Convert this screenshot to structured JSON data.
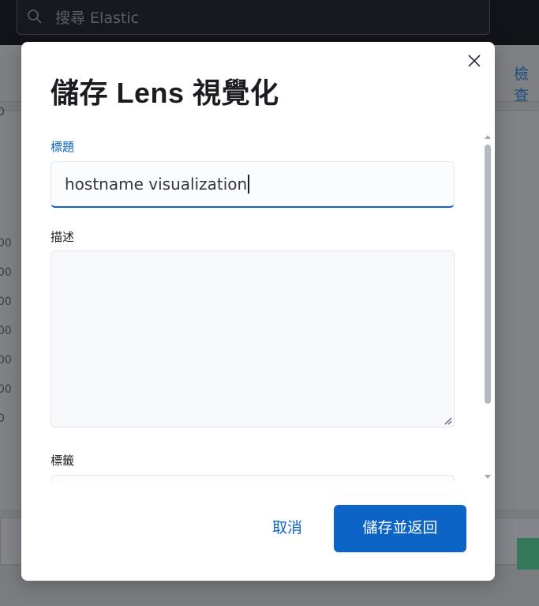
{
  "background": {
    "search": {
      "placeholder": "搜尋 Elastic"
    },
    "toolbar": {
      "inspect_label": "檢查"
    },
    "axis_ticks": [
      "0",
      "00",
      "00",
      "00",
      "00",
      "00",
      "00",
      "0"
    ]
  },
  "modal": {
    "title": "儲存 Lens 視覺化",
    "close_icon": "close-icon",
    "fields": {
      "title_label": "標題",
      "title_value": "hostname visualization",
      "description_label": "描述",
      "description_value": "",
      "tags_label": "標籤"
    },
    "footer": {
      "cancel_label": "取消",
      "save_label": "儲存並返回"
    }
  },
  "colors": {
    "accent": "#0b64c6",
    "title_text": "#1a1c21",
    "topbar": "#111318"
  }
}
